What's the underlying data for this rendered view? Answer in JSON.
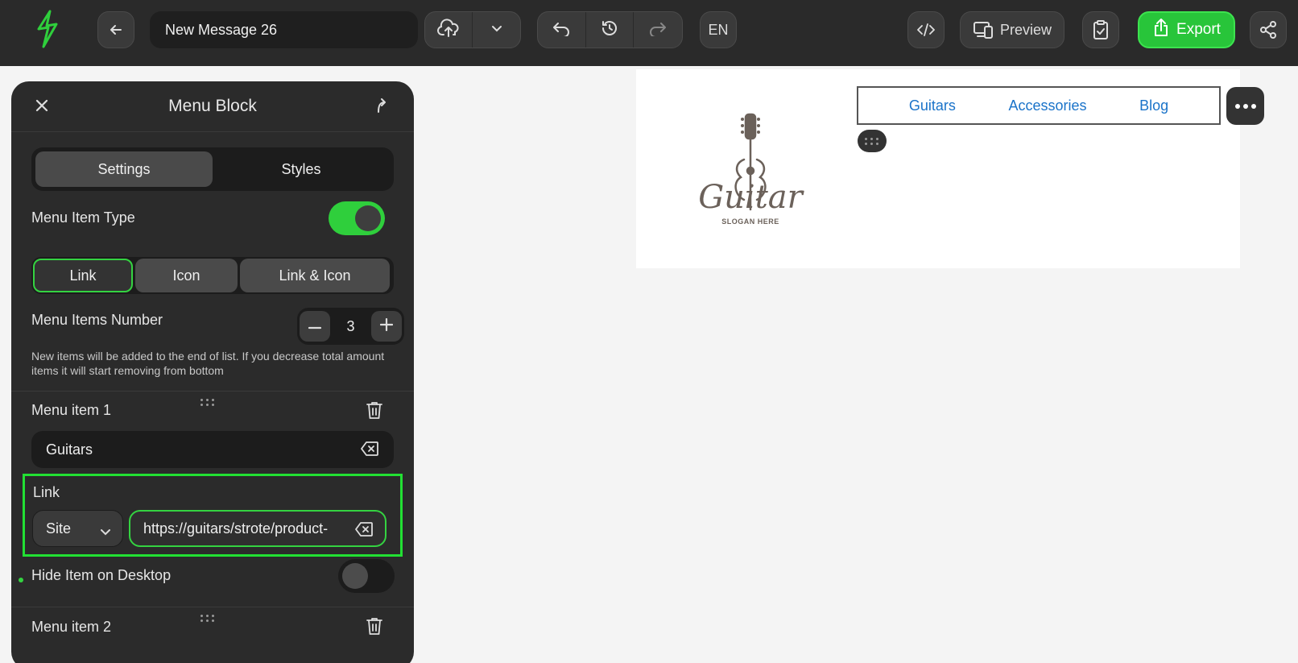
{
  "toolbar": {
    "message_title": "New Message 26",
    "language": "EN",
    "preview_label": "Preview",
    "export_label": "Export",
    "icons": {
      "logo": "brand-logo-icon",
      "back": "arrow-left-icon",
      "save": "cloud-upload-icon",
      "save_menu": "chevron-down-icon",
      "undo": "undo-icon",
      "history": "history-icon",
      "redo": "redo-icon",
      "code": "code-icon",
      "preview": "devices-icon",
      "test": "clipboard-check-icon",
      "export": "upload-icon",
      "share": "share-icon"
    }
  },
  "panel": {
    "title": "Menu Block",
    "tabs": [
      "Settings",
      "Styles"
    ],
    "active_tab": "Settings",
    "menu_item_type": {
      "label": "Menu Item Type",
      "toggle_on": true,
      "options": [
        "Link",
        "Icon",
        "Link & Icon"
      ],
      "selected": "Link"
    },
    "menu_items_number": {
      "label": "Menu Items Number",
      "value": "3"
    },
    "hint": "New items will be added to the end of list. If you decrease total amount items it will start removing from bottom",
    "items": [
      {
        "label": "Menu item 1",
        "text": "Guitars",
        "link_label": "Link",
        "link_type": "Site",
        "url": "https://guitars/strote/product-",
        "hide_on_desktop_label": "Hide Item on Desktop",
        "hide_on_desktop": false
      },
      {
        "label": "Menu item 2"
      }
    ]
  },
  "preview": {
    "logo": {
      "word": "Guitar",
      "slogan": "SLOGAN HERE"
    },
    "menu": [
      "Guitars",
      "Accessories",
      "Blog"
    ]
  },
  "colors": {
    "accent": "#2fcf3c",
    "toolbar_bg": "#2a2a2a",
    "panel_bg": "#2b2b2b",
    "link": "#1a73c9"
  }
}
